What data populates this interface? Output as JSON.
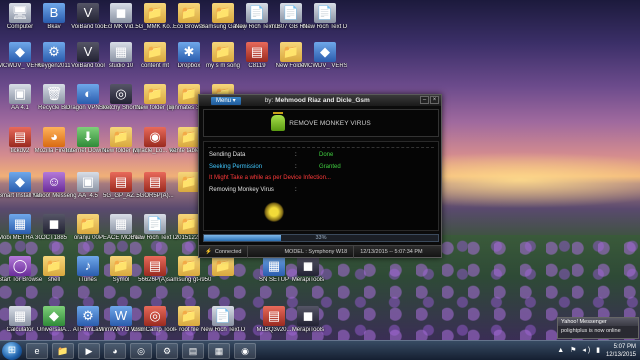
{
  "desktop": {
    "icons": [
      {
        "label": "Computer",
        "glyph": "🖥",
        "color": "gray"
      },
      {
        "label": "Bkav",
        "glyph": "B",
        "color": "blue"
      },
      {
        "label": "VoiBand tool",
        "glyph": "V",
        "color": "dark"
      },
      {
        "label": "Ecl MK Vid...",
        "glyph": "◼",
        "color": "gray"
      },
      {
        "label": "5G_MMK Ko...",
        "glyph": "📁",
        "color": "folder"
      },
      {
        "label": "Eco Browse",
        "glyph": "📁",
        "color": "folder"
      },
      {
        "label": "Samsung Galaxy Gra...",
        "glyph": "📁",
        "color": "folder"
      },
      {
        "label": "New Rich Text Do...",
        "glyph": "📄",
        "color": "gray"
      },
      {
        "label": "m:B07 GB Rtl...",
        "glyph": "📄",
        "color": "gray"
      },
      {
        "label": "New Rich Text Do...",
        "glyph": "📄",
        "color": "gray"
      },
      {
        "label": "MCWDV_ VERSION",
        "glyph": "◆",
        "color": "blue"
      },
      {
        "label": "Keygen2011",
        "glyph": "⚙",
        "color": "blue"
      },
      {
        "label": "VoiBand tool",
        "glyph": "V",
        "color": "dark"
      },
      {
        "label": "studio 10",
        "glyph": "▦",
        "color": "gray"
      },
      {
        "label": "content mt",
        "glyph": "📁",
        "color": "folder"
      },
      {
        "label": "Dropbox",
        "glyph": "✱",
        "color": "blue"
      },
      {
        "label": "my s m song",
        "glyph": "📁",
        "color": "folder"
      },
      {
        "label": "C8119",
        "glyph": "▤",
        "color": "red"
      },
      {
        "label": "New Folder",
        "glyph": "📁",
        "color": "folder"
      },
      {
        "label": "MCWDV_ VERSION",
        "glyph": "◆",
        "color": "blue"
      },
      {
        "label": "AA 4.1",
        "glyph": "▣",
        "color": "gray"
      },
      {
        "label": "Recycle Bin",
        "glyph": "🗑",
        "color": "gray"
      },
      {
        "label": "Dragon VPN Shortcut",
        "glyph": "◐",
        "color": "blue"
      },
      {
        "label": "Sketchy Shortcut",
        "glyph": "◎",
        "color": "dark"
      },
      {
        "label": "New folder (3)",
        "glyph": "📁",
        "color": "folder"
      },
      {
        "label": "winmates 3826",
        "glyph": "📁",
        "color": "folder"
      },
      {
        "label": "New folder (1)",
        "glyph": "📁",
        "color": "folder"
      },
      {
        "label": "tickdv2",
        "glyph": "▤",
        "color": "red"
      },
      {
        "label": "Mozilla Firefox",
        "glyph": "◕",
        "color": "orange"
      },
      {
        "label": "Internet Downlo...",
        "glyph": "⬇",
        "color": "green"
      },
      {
        "label": "New folder (2)",
        "glyph": "📁",
        "color": "folder"
      },
      {
        "label": "Miracle_Lo... WSc",
        "glyph": "◉",
        "color": "red"
      },
      {
        "label": "kente tablet_1",
        "glyph": "📁",
        "color": "folder"
      },
      {
        "label": "Smart Install Maker",
        "glyph": "◆",
        "color": "blue"
      },
      {
        "label": "Yahoo! Messenger",
        "glyph": "☺",
        "color": "purple"
      },
      {
        "label": "AA_4.5",
        "glyph": "▣",
        "color": "gray"
      },
      {
        "label": "5G_GP_AZ...",
        "glyph": "▤",
        "color": "red"
      },
      {
        "label": "5GOR5P(A)...",
        "glyph": "▤",
        "color": "red"
      },
      {
        "label": "",
        "glyph": "📁",
        "color": "folder"
      },
      {
        "label": "Mobi METRA 3G ver6.3",
        "glyph": "▦",
        "color": "blue"
      },
      {
        "label": "OCT1885",
        "glyph": "◼",
        "color": "dark"
      },
      {
        "label": "oranju 007",
        "glyph": "📁",
        "color": "folder"
      },
      {
        "label": "PEACE MOBILE...",
        "glyph": "▦",
        "color": "gray"
      },
      {
        "label": "New Rich Text Doc...",
        "glyph": "📄",
        "color": "gray"
      },
      {
        "label": "2015122...",
        "glyph": "📁",
        "color": "folder"
      },
      {
        "label": "Start Tor Browser",
        "glyph": "◯",
        "color": "purple"
      },
      {
        "label": "shell",
        "glyph": "📁",
        "color": "folder"
      },
      {
        "label": "iTunes",
        "glyph": "♪",
        "color": "blue"
      },
      {
        "label": "Symol",
        "glyph": "📁",
        "color": "folder"
      },
      {
        "label": "56626P(A)...",
        "glyph": "▤",
        "color": "red"
      },
      {
        "label": "samsung gt-i9500",
        "glyph": "📁",
        "color": "folder"
      },
      {
        "label": "",
        "glyph": "📁",
        "color": "folder"
      },
      {
        "label": "SN SETUP",
        "glyph": "▦",
        "color": "blue"
      },
      {
        "label": "MerapiTools",
        "glyph": "◼",
        "color": "dark"
      },
      {
        "label": "Calculator",
        "glyph": "▦",
        "color": "gray"
      },
      {
        "label": "UniversalA...",
        "glyph": "◆",
        "color": "green"
      },
      {
        "label": "ATFirmLast",
        "glyph": "⚙",
        "color": "blue"
      },
      {
        "label": "WinWWYO Web Builder...",
        "glyph": "W",
        "color": "blue"
      },
      {
        "label": "GsmCamp ToolPRO",
        "glyph": "◎",
        "color": "red"
      },
      {
        "label": "root file",
        "glyph": "📁",
        "color": "folder"
      },
      {
        "label": "New Rich Text Doc...",
        "glyph": "📄",
        "color": "gray"
      },
      {
        "label": "MLBQ3v20...",
        "glyph": "▤",
        "color": "red"
      },
      {
        "label": "MerapiTools",
        "glyph": "◼",
        "color": "dark"
      }
    ]
  },
  "app": {
    "menu_label": "Menu ▾",
    "author_prefix": "by:",
    "author_names": "Mehmood Riaz and Dicle_Gsm",
    "banner_title": "REMOVE MONKEY VIRUS",
    "rows": [
      {
        "key": "Sending Data",
        "colon": ":",
        "value": "Done",
        "key_color": "#e0e0e0",
        "value_color": "#40d040"
      },
      {
        "key": "Seeking Permission",
        "colon": ":",
        "value": "Granted",
        "key_color": "#40c8ff",
        "value_color": "#40d040"
      },
      {
        "key": "It Might Take a while as per Device Infection...",
        "colon": "",
        "value": "",
        "key_color": "#ff3a3a",
        "value_color": "#ff3a3a"
      },
      {
        "key": "Removing Monkey Virus",
        "colon": ":",
        "value": "",
        "key_color": "#e0e0e0",
        "value_color": "#e0e0e0"
      }
    ],
    "progress_label": "33%",
    "progress_fraction": 0.33,
    "status": {
      "connection": "Connected",
      "model": "MODEL : Symphony W18",
      "datetime": "12/13/2015 -- 5:07:34 PM"
    }
  },
  "taskbar": {
    "apps": [
      "e",
      "📁",
      "▶",
      "◕",
      "◎",
      "⚙",
      "▤",
      "▦",
      "◉"
    ],
    "tray_icons": "▲ ⚑ ◂) ▮",
    "time": "5:07 PM",
    "date": "12/13/2015"
  },
  "notification": {
    "title": "Yahoo! Messenger",
    "body": "polightplus is now online"
  }
}
